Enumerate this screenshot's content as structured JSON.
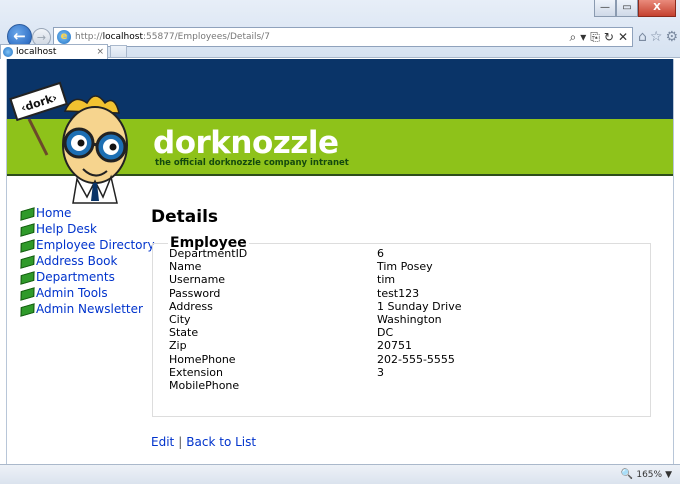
{
  "browser": {
    "url_prefix": "http://",
    "url_host": "localhost",
    "url_rest": ":55877/Employees/Details/7",
    "tab_title": "localhost",
    "tab_close": "×",
    "zoom": "165%",
    "minimize": "—",
    "maximize": "▭",
    "close": "X",
    "back": "←",
    "forward": "→",
    "search_glyph": "⌕",
    "dropdown_glyph": "▾",
    "compat_glyph": "⎘",
    "refresh_glyph": "↻",
    "stop_glyph": "✕",
    "home_glyph": "⌂",
    "favorites_glyph": "☆",
    "tools_glyph": "⚙",
    "zoom_glyph": "🔍",
    "zoom_dropdown": "▼"
  },
  "site": {
    "title": "dorknozzle",
    "tagline": "the official dorknozzle company intranet",
    "sign_text": "‹dork›"
  },
  "nav": {
    "items": [
      {
        "label": "Home"
      },
      {
        "label": "Help Desk"
      },
      {
        "label": "Employee Directory"
      },
      {
        "label": "Address Book"
      },
      {
        "label": "Departments"
      },
      {
        "label": "Admin Tools"
      },
      {
        "label": "Admin Newsletter"
      }
    ]
  },
  "details": {
    "heading": "Details",
    "legend": "Employee",
    "fields": [
      {
        "label": "DepartmentID",
        "value": "6"
      },
      {
        "label": "Name",
        "value": "Tim Posey"
      },
      {
        "label": "Username",
        "value": "tim"
      },
      {
        "label": "Password",
        "value": "test123"
      },
      {
        "label": "Address",
        "value": "1 Sunday Drive"
      },
      {
        "label": "City",
        "value": "Washington"
      },
      {
        "label": "State",
        "value": "DC"
      },
      {
        "label": "Zip",
        "value": "20751"
      },
      {
        "label": "HomePhone",
        "value": "202-555-5555"
      },
      {
        "label": "Extension",
        "value": "3"
      },
      {
        "label": "MobilePhone",
        "value": ""
      }
    ]
  },
  "actions": {
    "edit": "Edit",
    "separator": "|",
    "back": "Back to List"
  }
}
